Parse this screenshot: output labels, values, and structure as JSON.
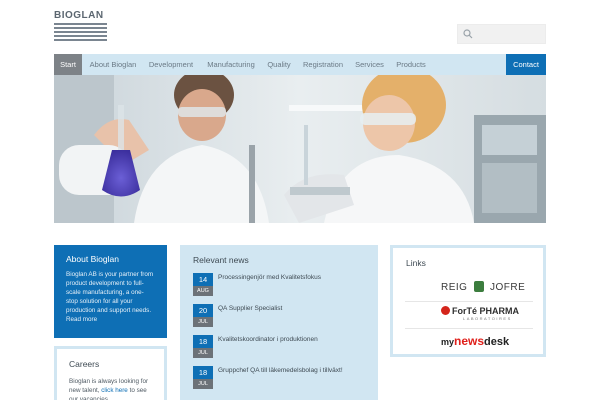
{
  "brand": {
    "name": "BIOGLAN"
  },
  "nav": {
    "items": [
      "Start",
      "About Bioglan",
      "Development",
      "Manufacturing",
      "Quality",
      "Registration",
      "Services",
      "Products"
    ],
    "contact": "Contact"
  },
  "about": {
    "title": "About Bioglan",
    "text": "Bioglan AB is your partner from product development to full-scale manufacturing, a one-stop solution for all your production and support needs.",
    "read_more": "Read more"
  },
  "careers": {
    "title": "Careers",
    "text_before": "Bioglan is always looking for new talent,",
    "link": "click here",
    "text_after": "to see our vacancies."
  },
  "news": {
    "title": "Relevant news",
    "items": [
      {
        "day": "14",
        "month": "AUG",
        "title": "Processingenjör med Kvalitetsfokus"
      },
      {
        "day": "20",
        "month": "JUL",
        "title": "QA Supplier Specialist"
      },
      {
        "day": "18",
        "month": "JUL",
        "title": "Kvalitetskoordinator i produktionen"
      },
      {
        "day": "18",
        "month": "JUL",
        "title": "Gruppchef QA till läkemedelsbolag i tillväxt!"
      }
    ]
  },
  "links": {
    "title": "Links",
    "logos": [
      {
        "left": "REIG",
        "right": "JOFRE"
      },
      {
        "main": "ForTé PHARMA",
        "sub": "LABORATOIRES"
      },
      {
        "pre": "my",
        "main": "news",
        "post": "desk"
      }
    ]
  },
  "colors": {
    "brand_blue": "#0e6fb5",
    "light_blue": "#d1e6f2",
    "nav_active": "#7d8287"
  }
}
